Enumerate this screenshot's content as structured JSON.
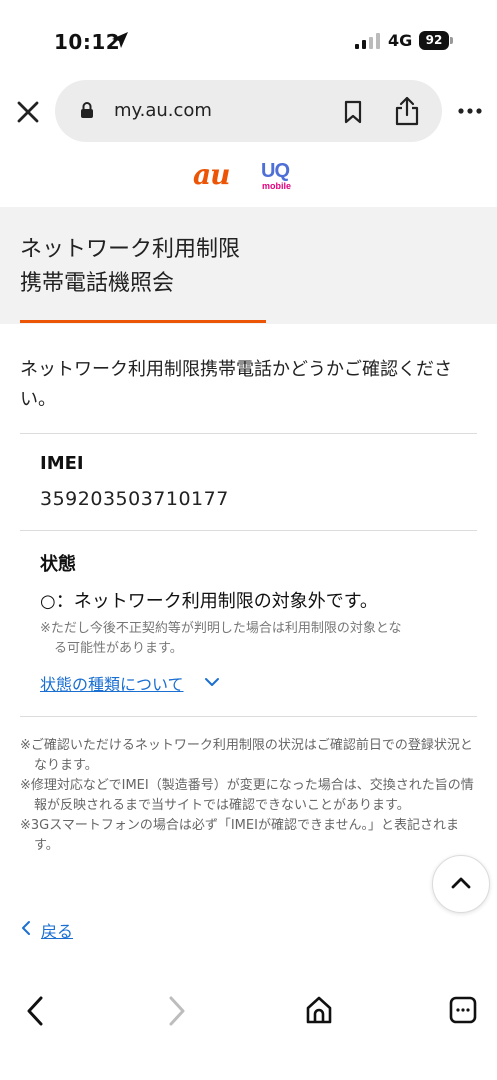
{
  "status_bar": {
    "time": "10:12",
    "network": "4G",
    "battery": "92"
  },
  "browser": {
    "url": "my.au.com"
  },
  "logos": {
    "au": "au",
    "uq_main": "UQ",
    "uq_sub": "mobile"
  },
  "page": {
    "title_line1": "ネットワーク利用制限",
    "title_line2": "携帯電話機照会",
    "intro": "ネットワーク利用制限携帯電話かどうかご確認ください。",
    "imei_label": "IMEI",
    "imei_value": "359203503710177",
    "state_label": "状態",
    "state_value": "○：ネットワーク利用制限の対象外です。",
    "state_note_line1": "※ただし今後不正契約等が判明した場合は利用制限の対象とな",
    "state_note_line2": "る可能性があります。",
    "types_link": "状態の種類について",
    "notes": [
      "※ご確認いただけるネットワーク利用制限の状況はご確認前日での登録状況となります。",
      "※修理対応などでIMEI（製造番号）が変更になった場合は、交換された旨の情報が反映されるまで当サイトでは確認できないことがあります。",
      "※3Gスマートフォンの場合は必ず「IMEIが確認できません。」と表記されます。"
    ],
    "back_link": "戻る"
  },
  "colors": {
    "accent": "#eb5505",
    "link": "#1a6fd1",
    "band": "#f2f2f2"
  }
}
